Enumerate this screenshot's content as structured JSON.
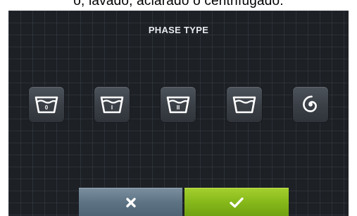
{
  "caption": "o, lavado, aclarado o centrifugado.",
  "screen": {
    "title": "PHASE TYPE",
    "phases": [
      {
        "icon": "prewash-tub-0-icon",
        "mark": "0"
      },
      {
        "icon": "wash-tub-1-icon",
        "mark": "I"
      },
      {
        "icon": "wash-tub-2-icon",
        "mark": "II"
      },
      {
        "icon": "rinse-tub-icon",
        "mark": ""
      },
      {
        "icon": "spin-spiral-icon",
        "mark": ""
      }
    ],
    "cancel": {
      "icon": "close-icon",
      "color": "#5d7384"
    },
    "confirm": {
      "icon": "checkmark-icon",
      "color": "#86b81a"
    }
  }
}
